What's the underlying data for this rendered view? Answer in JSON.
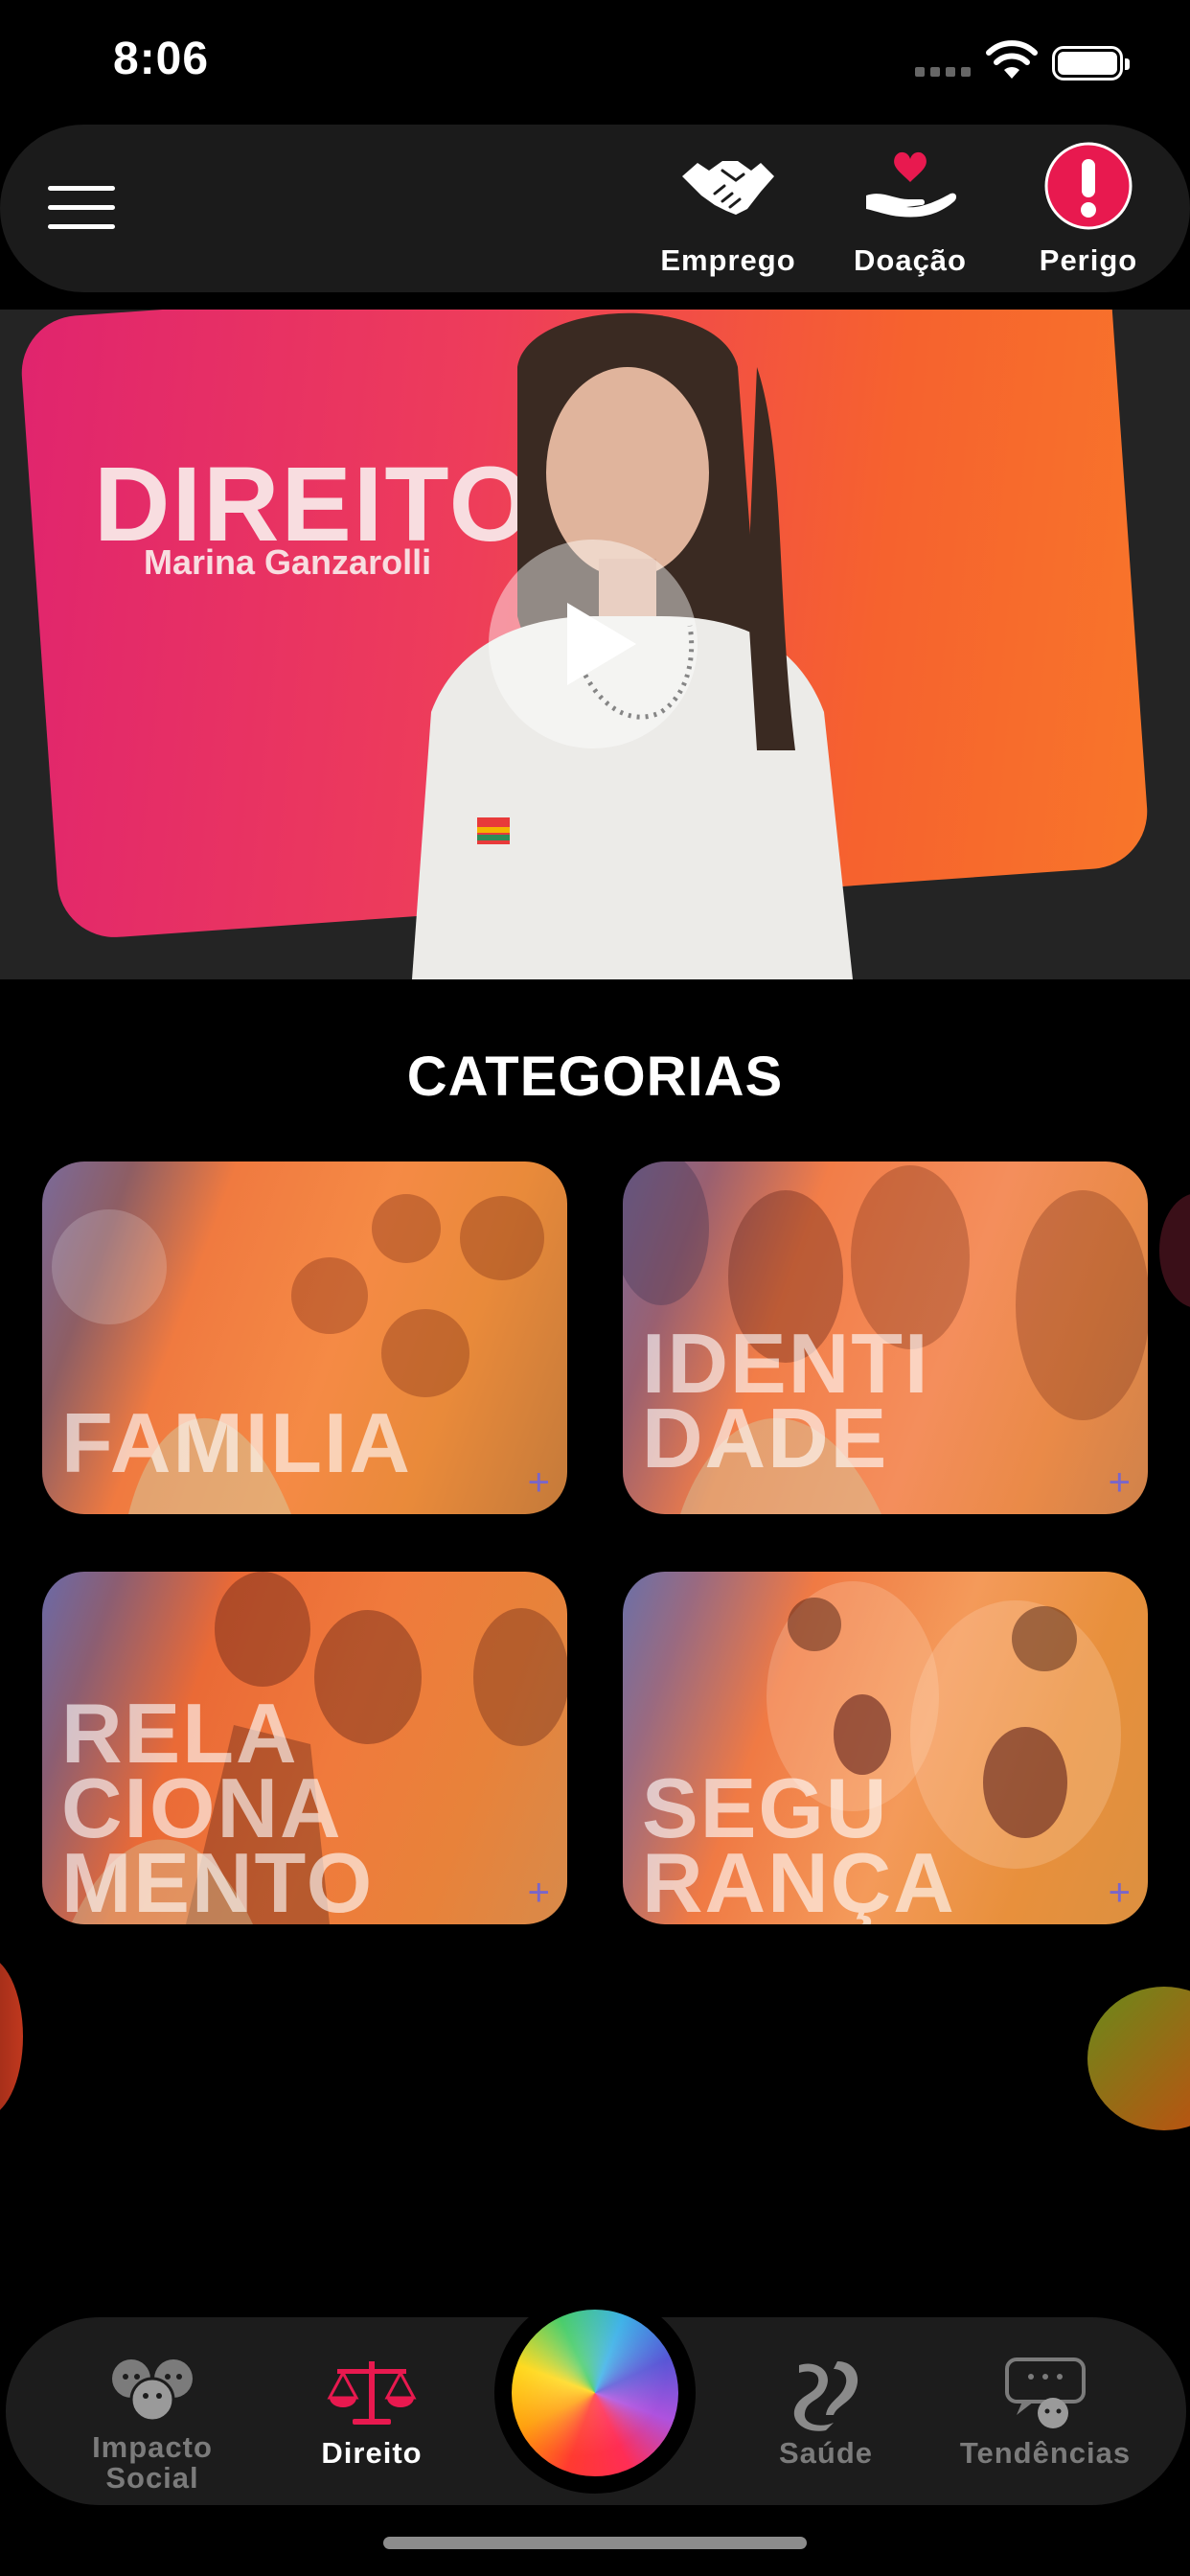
{
  "status_bar": {
    "time": "8:06"
  },
  "top_bar": {
    "actions": [
      {
        "label": "Emprego",
        "icon": "handshake-icon"
      },
      {
        "label": "Doação",
        "icon": "donation-hand-heart-icon"
      },
      {
        "label": "Perigo",
        "icon": "danger-alert-icon"
      }
    ]
  },
  "hero": {
    "title": "DIREITO",
    "subtitle": "Marina Ganzarolli"
  },
  "categories": {
    "title": "CATEGORIAS",
    "items": [
      {
        "label_lines": [
          "FAMILIA"
        ]
      },
      {
        "label_lines": [
          "IDENTI",
          "DADE"
        ]
      },
      {
        "label_lines": [
          "RELA",
          "CIONA",
          "MENTO"
        ]
      },
      {
        "label_lines": [
          "SEGU",
          "RANÇA"
        ]
      }
    ]
  },
  "tab_bar": {
    "items": [
      {
        "label_line1": "Impacto",
        "label_line2": "Social",
        "icon": "people-icon"
      },
      {
        "label": "Direito",
        "icon": "scales-icon",
        "active": true
      },
      {
        "label": "Saúde",
        "icon": "health-s-icon"
      },
      {
        "label": "Tendências",
        "icon": "chat-bubble-icon"
      }
    ]
  },
  "colors": {
    "accent": "#e8194f",
    "active_tab": "#ffffff",
    "inactive_tab": "#7b7b7b"
  }
}
